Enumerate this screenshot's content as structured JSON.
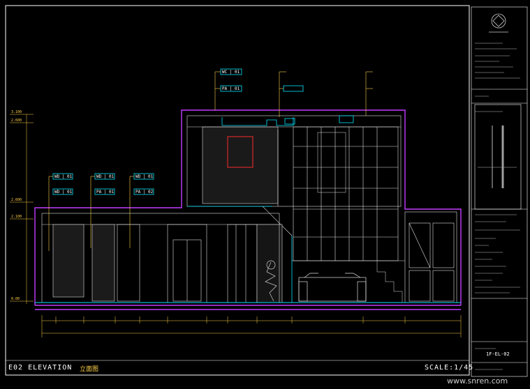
{
  "sheet": {
    "elevation_title": "E02 ELEVATION",
    "elevation_subtitle": "立面图",
    "scale": "SCALE:1/45",
    "sheet_number": "1F-EL-02"
  },
  "material_tags": [
    "WC | 01",
    "PA | 01",
    "WD | 01",
    "WD | 01",
    "WD | 01",
    "WD | 01",
    "PA | 01",
    "PA | 02"
  ],
  "levels": [
    "3.100",
    "2.600",
    "2.600",
    "2.100",
    "0.00"
  ],
  "watermark": "www.snren.com",
  "colors": {
    "background": "#000000",
    "frame": "#ffffff",
    "tag_box": "#00e5ff",
    "leader": "#ffd24a",
    "section_outline": "#c43cff",
    "detail_lines": "#e0e0e0",
    "artwork": "#ff2a2a"
  }
}
